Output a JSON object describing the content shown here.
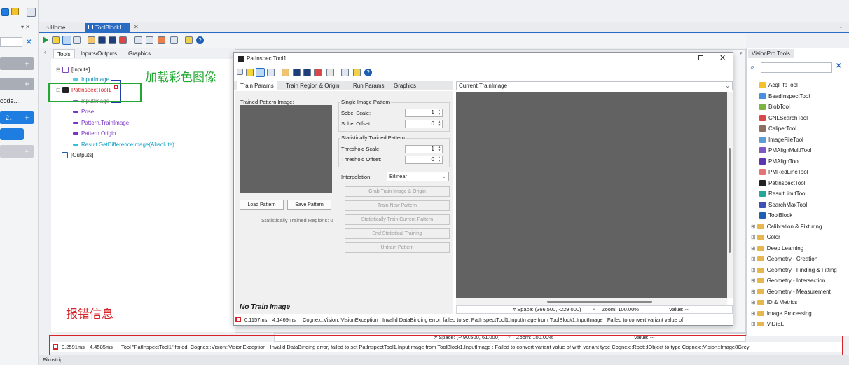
{
  "toolbar_top": {
    "labels": []
  },
  "left_strip": {
    "item_code": "code...",
    "badge": "2↓"
  },
  "tabs_top": {
    "home": "Home",
    "toolblock": "ToolBlock1"
  },
  "sub_tabs": {
    "tools": "Tools",
    "io": "Inputs/Outputs",
    "graphics": "Graphics"
  },
  "tree": {
    "inputs": "[Inputs]",
    "input_image": "InputImage",
    "tool": "PatInspectTool1",
    "tool_input": "InputImage",
    "pose": "Pose",
    "train_image": "Pattern.TrainImage",
    "origin": "Pattern.Origin",
    "result": "Result.GetDifferenceImage(Absolute)",
    "outputs": "[Outputs]"
  },
  "annotations": {
    "load_color": "加载彩色图像",
    "error_info": "报错信息"
  },
  "dialog": {
    "title": "PatInspectTool1",
    "tabs": [
      "Train Params",
      "Train Region & Origin",
      "Run Params",
      "Graphics"
    ],
    "trained_pattern_label": "Trained Pattern Image:",
    "single_image_pattern": "Single Image Pattern",
    "sobel_scale": "Sobel Scale:",
    "sobel_scale_val": "1",
    "sobel_offset": "Sobel Offset:",
    "sobel_offset_val": "0",
    "stat_trained": "Statistically Trained Pattern",
    "threshold_scale": "Threshold Scale:",
    "threshold_scale_val": "1",
    "threshold_offset": "Threshold Offset:",
    "threshold_offset_val": "0",
    "interpolation": "Interpolation:",
    "interpolation_val": "Bilinear",
    "grab": "Grab Train Image & Origin",
    "train_new": "Train New Pattern",
    "stat_train_current": "Statistically Train Current Pattern",
    "end_stat": "End Statistical Training",
    "untrain": "Untrain Pattern",
    "load_pattern": "Load Pattern",
    "save_pattern": "Save Pattern",
    "stat_regions": "Statistically Trained Regions: 0",
    "image_select": "Current.TrainImage",
    "no_train": "No Train Image",
    "space": "# Space: (366.500, -229.000)",
    "zoom": "Zoom: 100.00%",
    "value": "Value: --",
    "status_time1": "0.1157ms",
    "status_time2": "4.1469ms",
    "status_msg": "Cognex::Vision::VisionException : Invalid DataBinding error, failed to set PatInspectTool1.InputImage from ToolBlock1.InputImage : Failed to convert variant value of"
  },
  "main_display": {
    "space": "# Space: (-490.500, 61.000)",
    "zoom": "Zoom: 100.00%",
    "value": "Value: --"
  },
  "main_status": {
    "time1": "0.2591ms",
    "time2": "4.4585ms",
    "msg": "Tool \"PatInspectTool1\" failed. Cognex::Vision::VisionException : Invalid DataBinding error, failed to set PatInspectTool1.InputImage from ToolBlock1.InputImage : Failed to convert variant value of  with variant type Cognex::Rbbt::IObject to type Cognex::Vision::Image8Grey"
  },
  "filmstrip": "Filmstrip",
  "right_panel": {
    "title": "VisionPro Tools",
    "tools": [
      "AcqFifoTool",
      "BeadInspectTool",
      "BlobTool",
      "CNLSearchTool",
      "CaliperTool",
      "ImageFileTool",
      "PMAlignMultiTool",
      "PMAlignTool",
      "PMRedLineTool",
      "PatInspectTool",
      "ResultLimitTool",
      "SearchMaxTool",
      "ToolBlock"
    ],
    "folders": [
      "Calibration & Fixturing",
      "Color",
      "Deep Learning",
      "Geometry - Creation",
      "Geometry - Finding & Fitting",
      "Geometry - Intersection",
      "Geometry - Measurement",
      "ID & Metrics",
      "Image Processing",
      "ViDiEL"
    ]
  },
  "colors": {
    "accent": "#1e7de0",
    "error": "#d9232a",
    "annotation_green": "#22a832",
    "annotation_red": "#d9232a"
  }
}
